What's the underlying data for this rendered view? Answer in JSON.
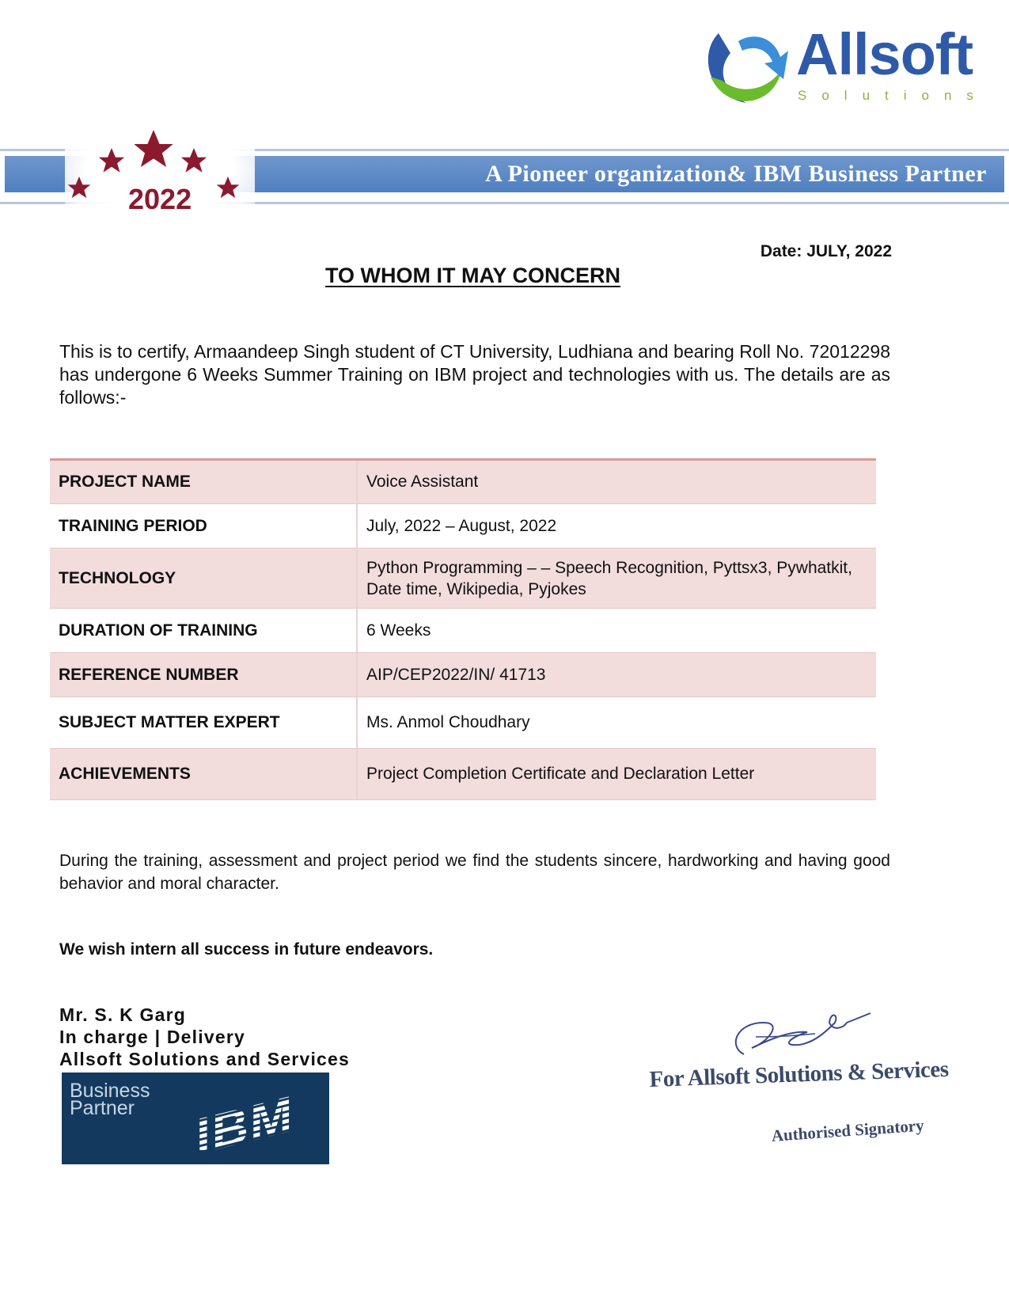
{
  "header": {
    "logo_name": "Allsoft",
    "logo_sub": "Solutions",
    "banner_text": "A Pioneer organization& IBM Business Partner",
    "badge_year": "2022",
    "colors": {
      "banner": "#4f7fc0",
      "logo_blue": "#2f5aa8",
      "logo_green": "#8db33a",
      "star_red": "#8b1a2e"
    }
  },
  "document": {
    "date": "Date: JULY, 2022",
    "title": "TO WHOM IT MAY CONCERN",
    "intro": "This is to certify, Armaandeep Singh  student of CT University, Ludhiana   and bearing Roll No. 72012298  has undergone 6 Weeks Summer Training on IBM project and technologies with us. The details are as follows:-",
    "details": [
      {
        "label": "PROJECT NAME",
        "value": "Voice Assistant"
      },
      {
        "label": "TRAINING PERIOD",
        "value": "July, 2022 – August, 2022"
      },
      {
        "label": "TECHNOLOGY",
        "value": "Python Programming – – Speech Recognition, Pyttsx3, Pywhatkit, Date time, Wikipedia, Pyjokes"
      },
      {
        "label": "DURATION OF TRAINING",
        "value": "6 Weeks"
      },
      {
        "label": "REFERENCE NUMBER",
        "value": "AIP/CEP2022/IN/ 41713"
      },
      {
        "label": "SUBJECT MATTER EXPERT",
        "value": "Ms. Anmol Choudhary"
      },
      {
        "label": "ACHIEVEMENTS",
        "value": "Project Completion Certificate and Declaration Letter"
      }
    ],
    "closing": "During the training, assessment and project period we find the students sincere, hardworking and having good behavior and moral character.",
    "wish": "We wish intern all success in future endeavors."
  },
  "signatory": {
    "name": "Mr. S. K Garg",
    "role": "In charge | Delivery",
    "company": "Allsoft Solutions and Services",
    "stamp_company": "For Allsoft Solutions & Services",
    "stamp_role": "Authorised Signatory"
  },
  "ibm_badge": {
    "line1": "Business",
    "line2": "Partner",
    "logo": "IBM"
  }
}
